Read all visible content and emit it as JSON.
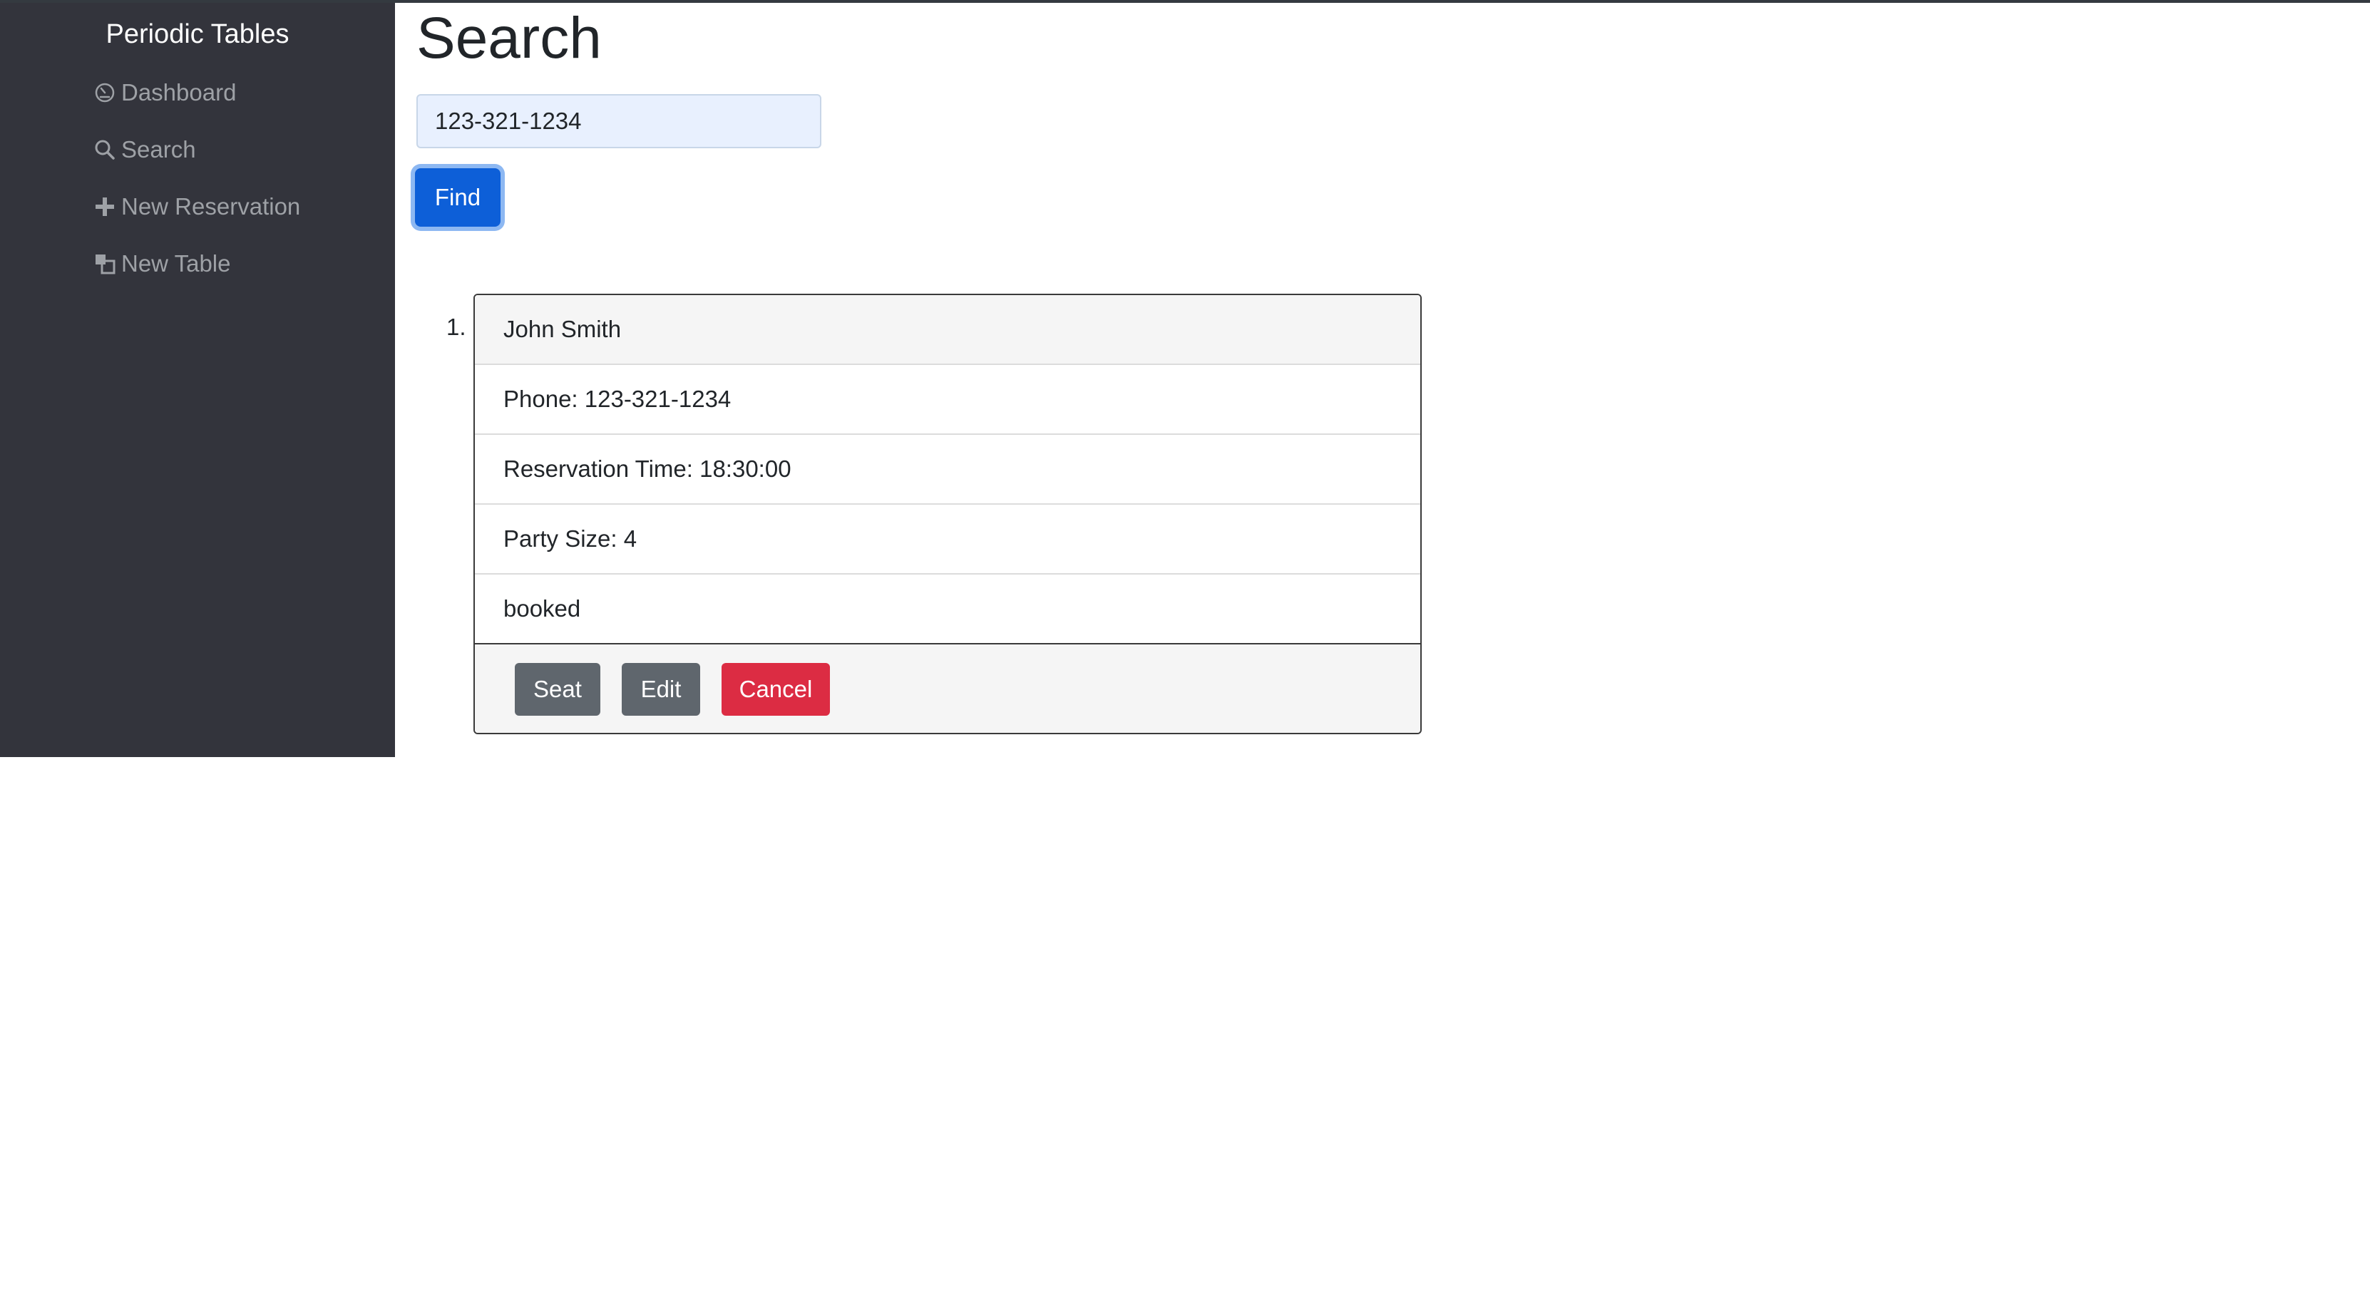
{
  "sidebar": {
    "brand": "Periodic Tables",
    "items": [
      {
        "label": "Dashboard",
        "icon": "dashboard-icon"
      },
      {
        "label": "Search",
        "icon": "search-icon"
      },
      {
        "label": "New Reservation",
        "icon": "plus-icon"
      },
      {
        "label": "New Table",
        "icon": "new-table-icon"
      }
    ]
  },
  "main": {
    "title": "Search",
    "search": {
      "value": "123-321-1234",
      "placeholder": ""
    },
    "find_label": "Find"
  },
  "results": [
    {
      "number": "1.",
      "name": "John Smith",
      "phone": "Phone: 123-321-1234",
      "time": "Reservation Time: 18:30:00",
      "party": "Party Size: 4",
      "status": "booked",
      "actions": {
        "seat": "Seat",
        "edit": "Edit",
        "cancel": "Cancel"
      }
    }
  ],
  "colors": {
    "sidebar_bg": "#33343c",
    "primary": "#0d5fd8",
    "secondary": "#5f666d",
    "danger": "#dc2c43"
  }
}
